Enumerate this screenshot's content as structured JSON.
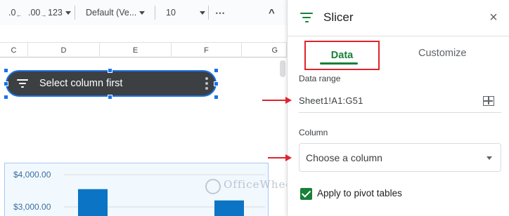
{
  "toolbar": {
    "decrease_decimal": ".0",
    "decrease_decimal_sub": "←",
    "increase_decimal": ".00",
    "increase_decimal_sub": "→",
    "number_format": "123",
    "font": "Default (Ve...",
    "font_size": "10",
    "more": "⋯",
    "collapse": "^"
  },
  "columns": [
    "C",
    "D",
    "E",
    "F",
    "G"
  ],
  "slicer": {
    "label": "Select column first"
  },
  "chart_data": {
    "type": "bar",
    "title": "",
    "ytick_labels": [
      "$4,000.00",
      "$3,000.00"
    ],
    "values": [
      3550,
      3200
    ],
    "ylim": [
      2700,
      4300
    ],
    "bar_color": "#0b74c4"
  },
  "panel": {
    "title": "Slicer",
    "close": "×",
    "tabs": [
      {
        "label": "Data",
        "active": true
      },
      {
        "label": "Customize",
        "active": false
      }
    ],
    "data_range_label": "Data range",
    "data_range_value": "Sheet1!A1:G51",
    "column_label": "Column",
    "column_placeholder": "Choose a column",
    "apply_pivot_label": "Apply to pivot tables",
    "apply_pivot_checked": true
  },
  "colors": {
    "accent_green": "#188038",
    "selection_blue": "#1a73e8",
    "annotation_red": "#e0242d"
  },
  "watermark": "OfficeWheel"
}
